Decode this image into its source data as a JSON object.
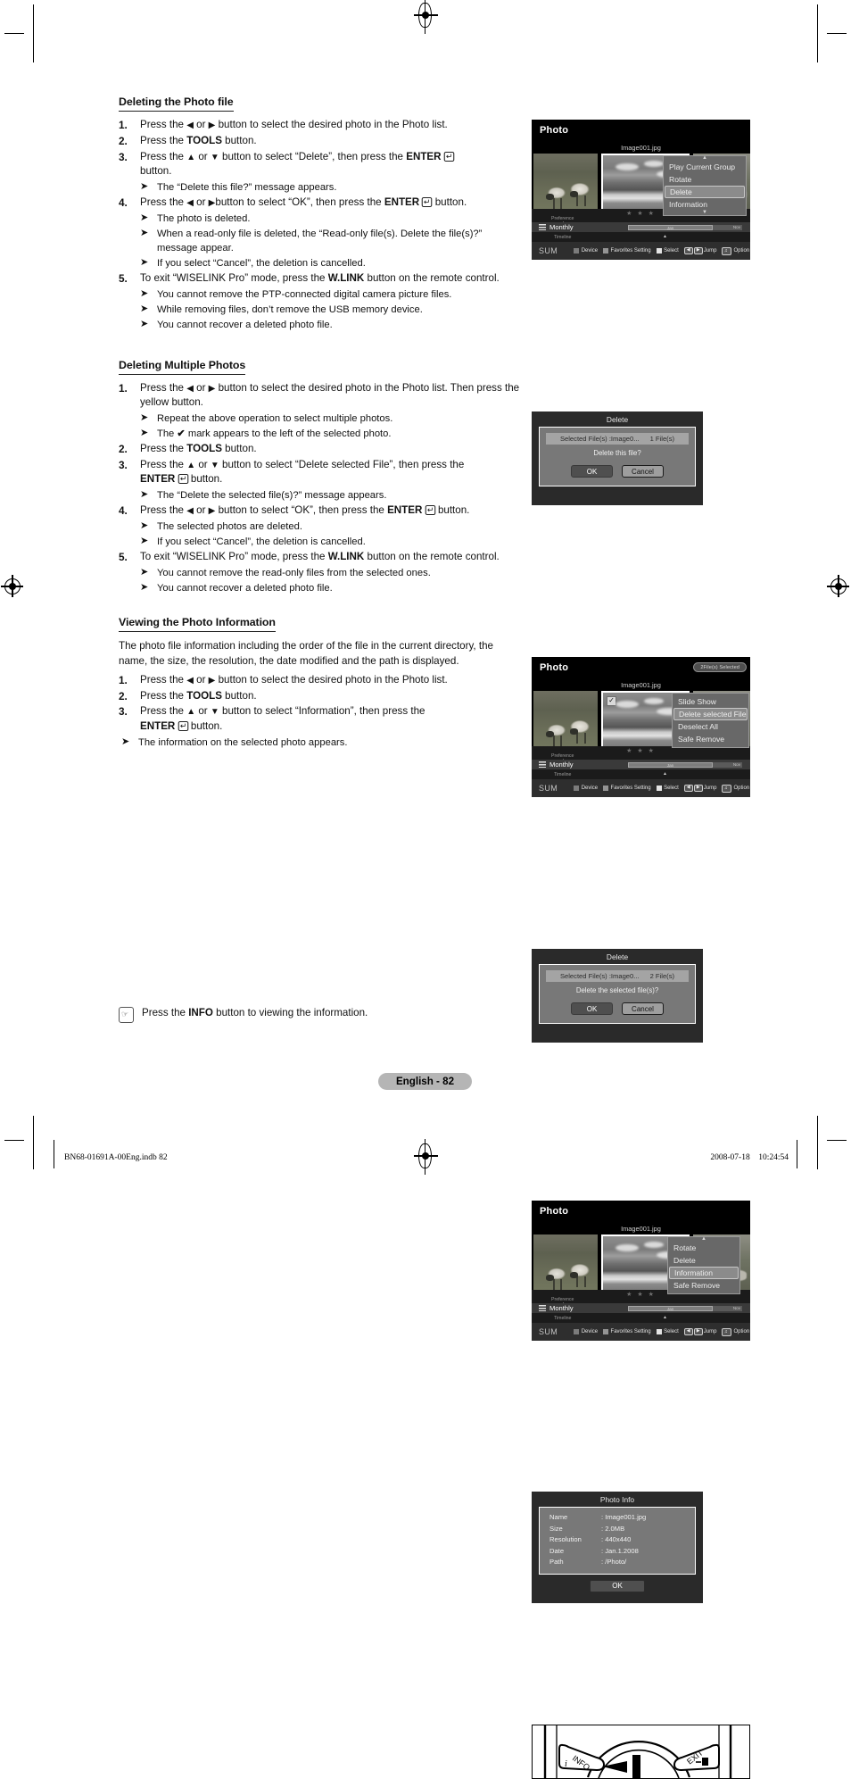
{
  "document": {
    "page_label": "English - 82",
    "footer_left": "BN68-01691A-00Eng.indb   82",
    "footer_right": "2008-07-18      10:24:54"
  },
  "sections": [
    {
      "heading": "Deleting the Photo file",
      "steps": [
        {
          "num": "1.",
          "text": "Press the ◀ or ▶ button to select the desired photo in the Photo list."
        },
        {
          "num": "2.",
          "text": "Press the TOOLS button."
        },
        {
          "num": "3.",
          "text": "Press the ▲ or ▼ button to select “Delete”, then press the ENTER ↵ button."
        }
      ],
      "notes": [
        "The “Delete this file?” message appears."
      ],
      "step4": {
        "num": "4.",
        "text": "Press the ◀ or ▶button to select “OK”, then press the ENTER ↵ button."
      },
      "notes4": [
        "The photo is deleted.",
        "When a read-only file is deleted, the “Read-only file(s). Delete the file(s)?” message appear.",
        "If you select “Cancel”, the deletion is cancelled."
      ],
      "step5": {
        "num": "5.",
        "text": "To exit “WISELINK Pro” mode, press the W.LINK button on the remote control."
      },
      "notes5": [
        "You cannot remove the PTP-connected digital camera picture files.",
        "While removing files, don’t remove the USB memory device.",
        "You cannot recover a deleted photo file."
      ]
    },
    {
      "heading": "Deleting Multiple Photos",
      "step1": {
        "num": "1.",
        "text": "Press the ◀ or ▶ button to select the desired photo in the Photo list. Then press the yellow button."
      },
      "notes1": [
        "Repeat the above operation to select multiple photos.",
        "The ✔ mark appears to the left of the selected photo."
      ],
      "step2": {
        "num": "2.",
        "text": "Press the TOOLS button."
      },
      "step3": {
        "num": "3.",
        "text": "Press the ▲ or ▼ button to select “Delete selected File”, then press the ENTER ↵ button."
      },
      "notes3": [
        "The “Delete the selected file(s)?” message appears."
      ],
      "step4": {
        "num": "4.",
        "text": "Press the ◀ or ▶ button to select “OK”, then press the ENTER ↵ button."
      },
      "notes4": [
        "The selected photos are deleted.",
        "If you select “Cancel”, the deletion is cancelled."
      ],
      "step5": {
        "num": "5.",
        "text": "To exit “WISELINK Pro” mode, press the W.LINK button on the remote control."
      },
      "notes5": [
        "You cannot remove the read-only files from the selected ones.",
        "You cannot recover a deleted photo file."
      ]
    },
    {
      "heading": "Viewing the Photo Information",
      "intro": "The photo file information including the order of the file in the current directory, the name, the size, the resolution, the date modified and the path is displayed.",
      "step1": {
        "num": "1.",
        "text": "Press the ◀ or ▶ button to select the desired photo in the Photo list."
      },
      "step2": {
        "num": "2.",
        "text": "Press the TOOLS button."
      },
      "step3": {
        "num": "3.",
        "text": "Press the ▲ or ▼ button to select “Information”, then press the ENTER ↵ button."
      },
      "final_note": "The information on the selected photo appears."
    }
  ],
  "bottom_note": {
    "icon": "note-hand-icon",
    "text_before": "Press the ",
    "bold": "INFO",
    "text_after": " button to viewing the information."
  },
  "screens": [
    {
      "id": "photo-delete",
      "title": "Photo",
      "badge": "",
      "filename": "Image001.jpg",
      "menu": {
        "items": [
          "Play Current Group",
          "Rotate",
          "Delete",
          "Information"
        ],
        "selected": "Delete",
        "has_up_caret": true,
        "has_down_caret": true
      },
      "checkmark_visible": false,
      "preference_label": "Preference",
      "timeline_label": "Timeline",
      "sort_label": "Monthly",
      "tl_start": "Jan",
      "tl_end": "Nov",
      "keybar": {
        "sum": "SUM",
        "keys": [
          {
            "swatch": "red",
            "label": "Device"
          },
          {
            "swatch": "green",
            "label": "Favorites Setting"
          },
          {
            "swatch": "yellow",
            "label": "Select"
          },
          {
            "swatch": "jump",
            "label": "Jump"
          },
          {
            "swatch": "option",
            "label": "Option"
          }
        ]
      }
    },
    {
      "id": "photo-multi-delete",
      "title": "Photo",
      "badge": "2File(s) Selected",
      "filename": "Image001.jpg",
      "menu": {
        "items": [
          "Slide Show",
          "Delete selected File",
          "Deselect All",
          "Safe Remove"
        ],
        "selected": "Delete selected File",
        "has_up_caret": false,
        "has_down_caret": false
      },
      "checkmark_visible": true,
      "preference_label": "Preference",
      "timeline_label": "Timeline",
      "sort_label": "Monthly",
      "tl_start": "Jan",
      "tl_end": "Nov",
      "keybar": {
        "sum": "SUM",
        "keys": [
          {
            "swatch": "red",
            "label": "Device"
          },
          {
            "swatch": "green",
            "label": "Favorites Setting"
          },
          {
            "swatch": "yellow",
            "label": "Select"
          },
          {
            "swatch": "jump",
            "label": "Jump"
          },
          {
            "swatch": "option",
            "label": "Option"
          }
        ]
      }
    },
    {
      "id": "photo-information",
      "title": "Photo",
      "badge": "",
      "filename": "Image001.jpg",
      "menu": {
        "items": [
          "Rotate",
          "Delete",
          "Information",
          "Safe Remove"
        ],
        "selected": "Information",
        "has_up_caret": true,
        "has_down_caret": false
      },
      "checkmark_visible": false,
      "preference_label": "Preference",
      "timeline_label": "Timeline",
      "sort_label": "Monthly",
      "tl_start": "Jan",
      "tl_end": "Nov",
      "keybar": {
        "sum": "SUM",
        "keys": [
          {
            "swatch": "red",
            "label": "Device"
          },
          {
            "swatch": "green",
            "label": "Favorites Setting"
          },
          {
            "swatch": "yellow",
            "label": "Select"
          },
          {
            "swatch": "jump",
            "label": "Jump"
          },
          {
            "swatch": "option",
            "label": "Option"
          }
        ]
      }
    }
  ],
  "dialogs": [
    {
      "id": "delete-single",
      "title": "Delete",
      "file_row": "Selected File(s) :Image0...",
      "file_count": "1 File(s)",
      "question": "Delete this file?",
      "ok": "OK",
      "cancel": "Cancel"
    },
    {
      "id": "delete-multiple",
      "title": "Delete",
      "file_row": "Selected File(s) :Image0...",
      "file_count": "2 File(s)",
      "question": "Delete the selected file(s)?",
      "ok": "OK",
      "cancel": "Cancel"
    }
  ],
  "photo_info": {
    "title": "Photo Info",
    "rows": [
      {
        "label": "Name",
        "value": ": Image001.jpg"
      },
      {
        "label": "Size",
        "value": ": 2.0MB"
      },
      {
        "label": "Resolution",
        "value": ": 440x440"
      },
      {
        "label": "Date",
        "value": ": Jan.1.2008"
      },
      {
        "label": "Path",
        "value": ": /Photo/"
      }
    ],
    "ok": "OK"
  },
  "remote": {
    "info_label": "INFO",
    "info_sub": "i",
    "exit_label": "EXIT"
  }
}
